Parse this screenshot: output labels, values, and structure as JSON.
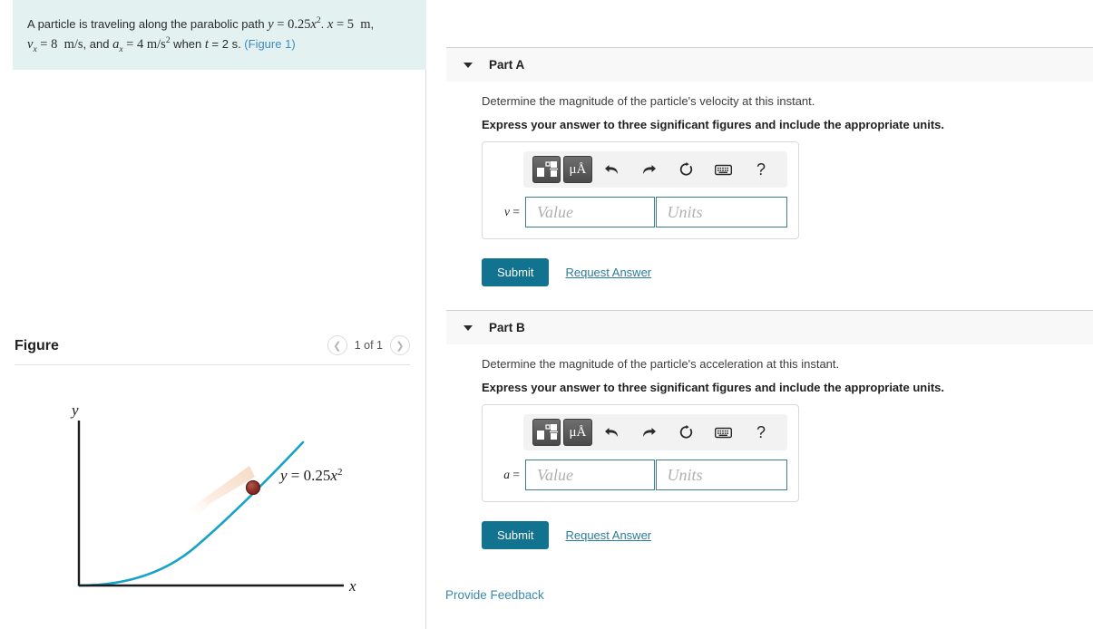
{
  "problem": {
    "text_segments": [
      "A particle is traveling along the parabolic path ",
      "y = 0.25x",
      ". ",
      "x = 5  m",
      ", ",
      "v",
      "x",
      " = 8  m/s",
      ", and ",
      "a",
      "x",
      " = 4 m/s",
      " when ",
      "t",
      " = 2 s. "
    ],
    "plain": "A particle is traveling along the parabolic path y = 0.25x^2. x = 5 m, v_x = 8 m/s, and a_x = 4 m/s^2 when t = 2 s. (Figure 1)",
    "figure_link_label": "(Figure 1)",
    "background_color": "#e3f1f1",
    "link_color": "#3f8bbf"
  },
  "figure": {
    "title": "Figure",
    "counter": "1 of 1",
    "prev_icon": "chevron-left-icon",
    "next_icon": "chevron-right-icon",
    "y_axis_label": "y",
    "x_axis_label": "x",
    "curve_equation": "y = 0.25x",
    "curve_exponent": "2",
    "curve_color": "#17a2c9",
    "particle_color": "#8e2f28",
    "trail_color": "#f7e2d3",
    "axis_color": "#1b1b1b"
  },
  "parts": [
    {
      "id": "part-a",
      "label": "Part A",
      "caret_icon": "caret-down-icon",
      "prompt": "Determine the magnitude of the particle's velocity at this instant.",
      "instruction": "Express your answer to three significant figures and include the appropriate units.",
      "variable": "v",
      "equals": " =",
      "value_placeholder": "Value",
      "units_placeholder": "Units",
      "value_current": "",
      "units_current": "",
      "submit_label": "Submit",
      "request_answer_label": "Request Answer",
      "toolbar": [
        {
          "name": "template-button",
          "kind": "template"
        },
        {
          "name": "units-button",
          "kind": "units",
          "label": "μÅ"
        },
        {
          "name": "undo-icon",
          "kind": "undo"
        },
        {
          "name": "redo-icon",
          "kind": "redo"
        },
        {
          "name": "reset-icon",
          "kind": "reset"
        },
        {
          "name": "keyboard-icon",
          "kind": "keyboard"
        },
        {
          "name": "help-icon",
          "kind": "help",
          "label": "?"
        }
      ]
    },
    {
      "id": "part-b",
      "label": "Part B",
      "caret_icon": "caret-down-icon",
      "prompt": "Determine the magnitude of the particle's acceleration at this instant.",
      "instruction": "Express your answer to three significant figures and include the appropriate units.",
      "variable": "a",
      "equals": " =",
      "value_placeholder": "Value",
      "units_placeholder": "Units",
      "value_current": "",
      "units_current": "",
      "submit_label": "Submit",
      "request_answer_label": "Request Answer",
      "toolbar": [
        {
          "name": "template-button",
          "kind": "template"
        },
        {
          "name": "units-button",
          "kind": "units",
          "label": "μÅ"
        },
        {
          "name": "undo-icon",
          "kind": "undo"
        },
        {
          "name": "redo-icon",
          "kind": "redo"
        },
        {
          "name": "reset-icon",
          "kind": "reset"
        },
        {
          "name": "keyboard-icon",
          "kind": "keyboard"
        },
        {
          "name": "help-icon",
          "kind": "help",
          "label": "?"
        }
      ]
    }
  ],
  "footer": {
    "feedback_label": "Provide Feedback"
  },
  "colors": {
    "submit_button": "#11738f",
    "link": "#2c7c9c",
    "part_header_bg": "#f8f8f8",
    "field_border": "#3e7f89"
  }
}
